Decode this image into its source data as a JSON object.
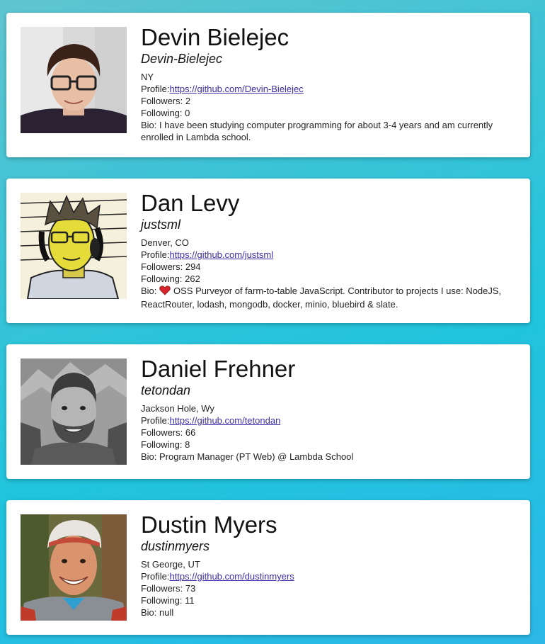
{
  "users": [
    {
      "name": "Devin Bielejec",
      "login": "Devin-Bielejec",
      "location": "NY",
      "profile_prefix": "Profile:",
      "profile_url": "https://github.com/Devin-Bielejec",
      "followers": "Followers: 2",
      "following": "Following: 0",
      "bio": "Bio: I have been studying computer programming for about 3-4 years and am currently enrolled in Lambda school."
    },
    {
      "name": "Dan Levy",
      "login": "justsml",
      "location": "Denver, CO",
      "profile_prefix": "Profile:",
      "profile_url": "https://github.com/justsml",
      "followers": "Followers: 294",
      "following": "Following: 262",
      "bio_prefix": "Bio:",
      "bio_icon": "heart-icon",
      "bio": "OSS Purveyor of farm-to-table JavaScript. Contributor to projects I use: NodeJS, ReactRouter, lodash, mongodb, docker, minio, bluebird & slate."
    },
    {
      "name": "Daniel Frehner",
      "login": "tetondan",
      "location": "Jackson Hole, Wy",
      "profile_prefix": "Profile:",
      "profile_url": "https://github.com/tetondan",
      "followers": "Followers: 66",
      "following": "Following: 8",
      "bio": "Bio: Program Manager (PT Web) @ Lambda School"
    },
    {
      "name": "Dustin Myers",
      "login": "dustinmyers",
      "location": "St George, UT",
      "profile_prefix": "Profile:",
      "profile_url": "https://github.com/dustinmyers",
      "followers": "Followers: 73",
      "following": "Following: 11",
      "bio": "Bio: null"
    }
  ],
  "colors": {
    "link": "#3b2ea6",
    "background_start": "#5fc5cf",
    "background_end": "#2bb8e8",
    "heart": "#d7262b"
  }
}
